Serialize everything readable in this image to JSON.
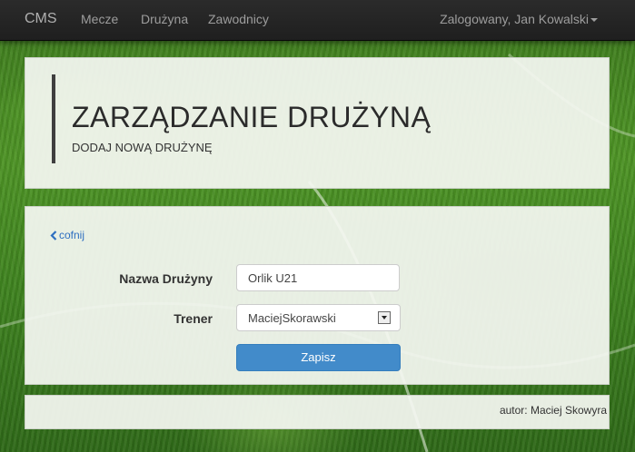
{
  "navbar": {
    "brand": "CMS",
    "links": [
      {
        "label": "Mecze"
      },
      {
        "label": "Drużyna"
      },
      {
        "label": "Zawodnicy"
      }
    ],
    "user_menu": "Zalogowany, Jan Kowalski"
  },
  "header": {
    "title": "ZARZĄDZANIE DRUŻYNĄ",
    "subtitle": "DODAJ NOWĄ DRUŻYNĘ"
  },
  "form": {
    "back_link": "cofnij",
    "team_name_label": "Nazwa Drużyny",
    "team_name_value": "Orlik U21",
    "coach_label": "Trener",
    "coach_selected": "MaciejSkorawski",
    "submit_label": "Zapisz"
  },
  "footer": {
    "text": "autor: Maciej Skowyra"
  },
  "colors": {
    "navbar_bg": "#222222",
    "primary_button": "#428bca",
    "link": "#2e6fc0"
  }
}
